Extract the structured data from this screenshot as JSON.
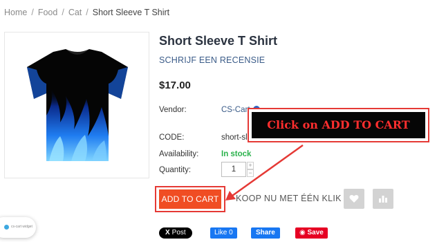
{
  "breadcrumb": {
    "items": [
      "Home",
      "Food",
      "Cat"
    ],
    "separator": "/",
    "current": "Short Sleeve T Shirt"
  },
  "product": {
    "title": "Short Sleeve T Shirt",
    "review_link": "SCHRIJF EEN RECENSIE",
    "price": "$17.00",
    "image_icon": "flame-tshirt-image",
    "vendor_label": "Vendor:",
    "vendor_value": "CS-Cart",
    "code_label": "CODE:",
    "code_value": "short-sl",
    "availability_label": "Availability:",
    "availability_value": "In stock",
    "quantity_label": "Quantity:",
    "quantity_value": "1"
  },
  "actions": {
    "add_to_cart": "ADD TO CART",
    "buy_one_click": "KOOP NU MET ÉÉN KLIK",
    "wishlist_icon": "heart-icon",
    "compare_icon": "bar-chart-icon"
  },
  "annotation": {
    "callout_text": "Click on ADD TO CART",
    "frame_color": "#e53935",
    "text_color": "#ff2e2e"
  },
  "social": {
    "x_post": "Post",
    "x_logo": "X",
    "fb_like": "Like 0",
    "fb_share": "Share",
    "pinterest_save": "Save"
  },
  "chat_widget": {
    "label": "cs-cart widget"
  },
  "colors": {
    "accent": "#f04d23",
    "in_stock": "#2bb24c",
    "link": "#3a5b88"
  }
}
